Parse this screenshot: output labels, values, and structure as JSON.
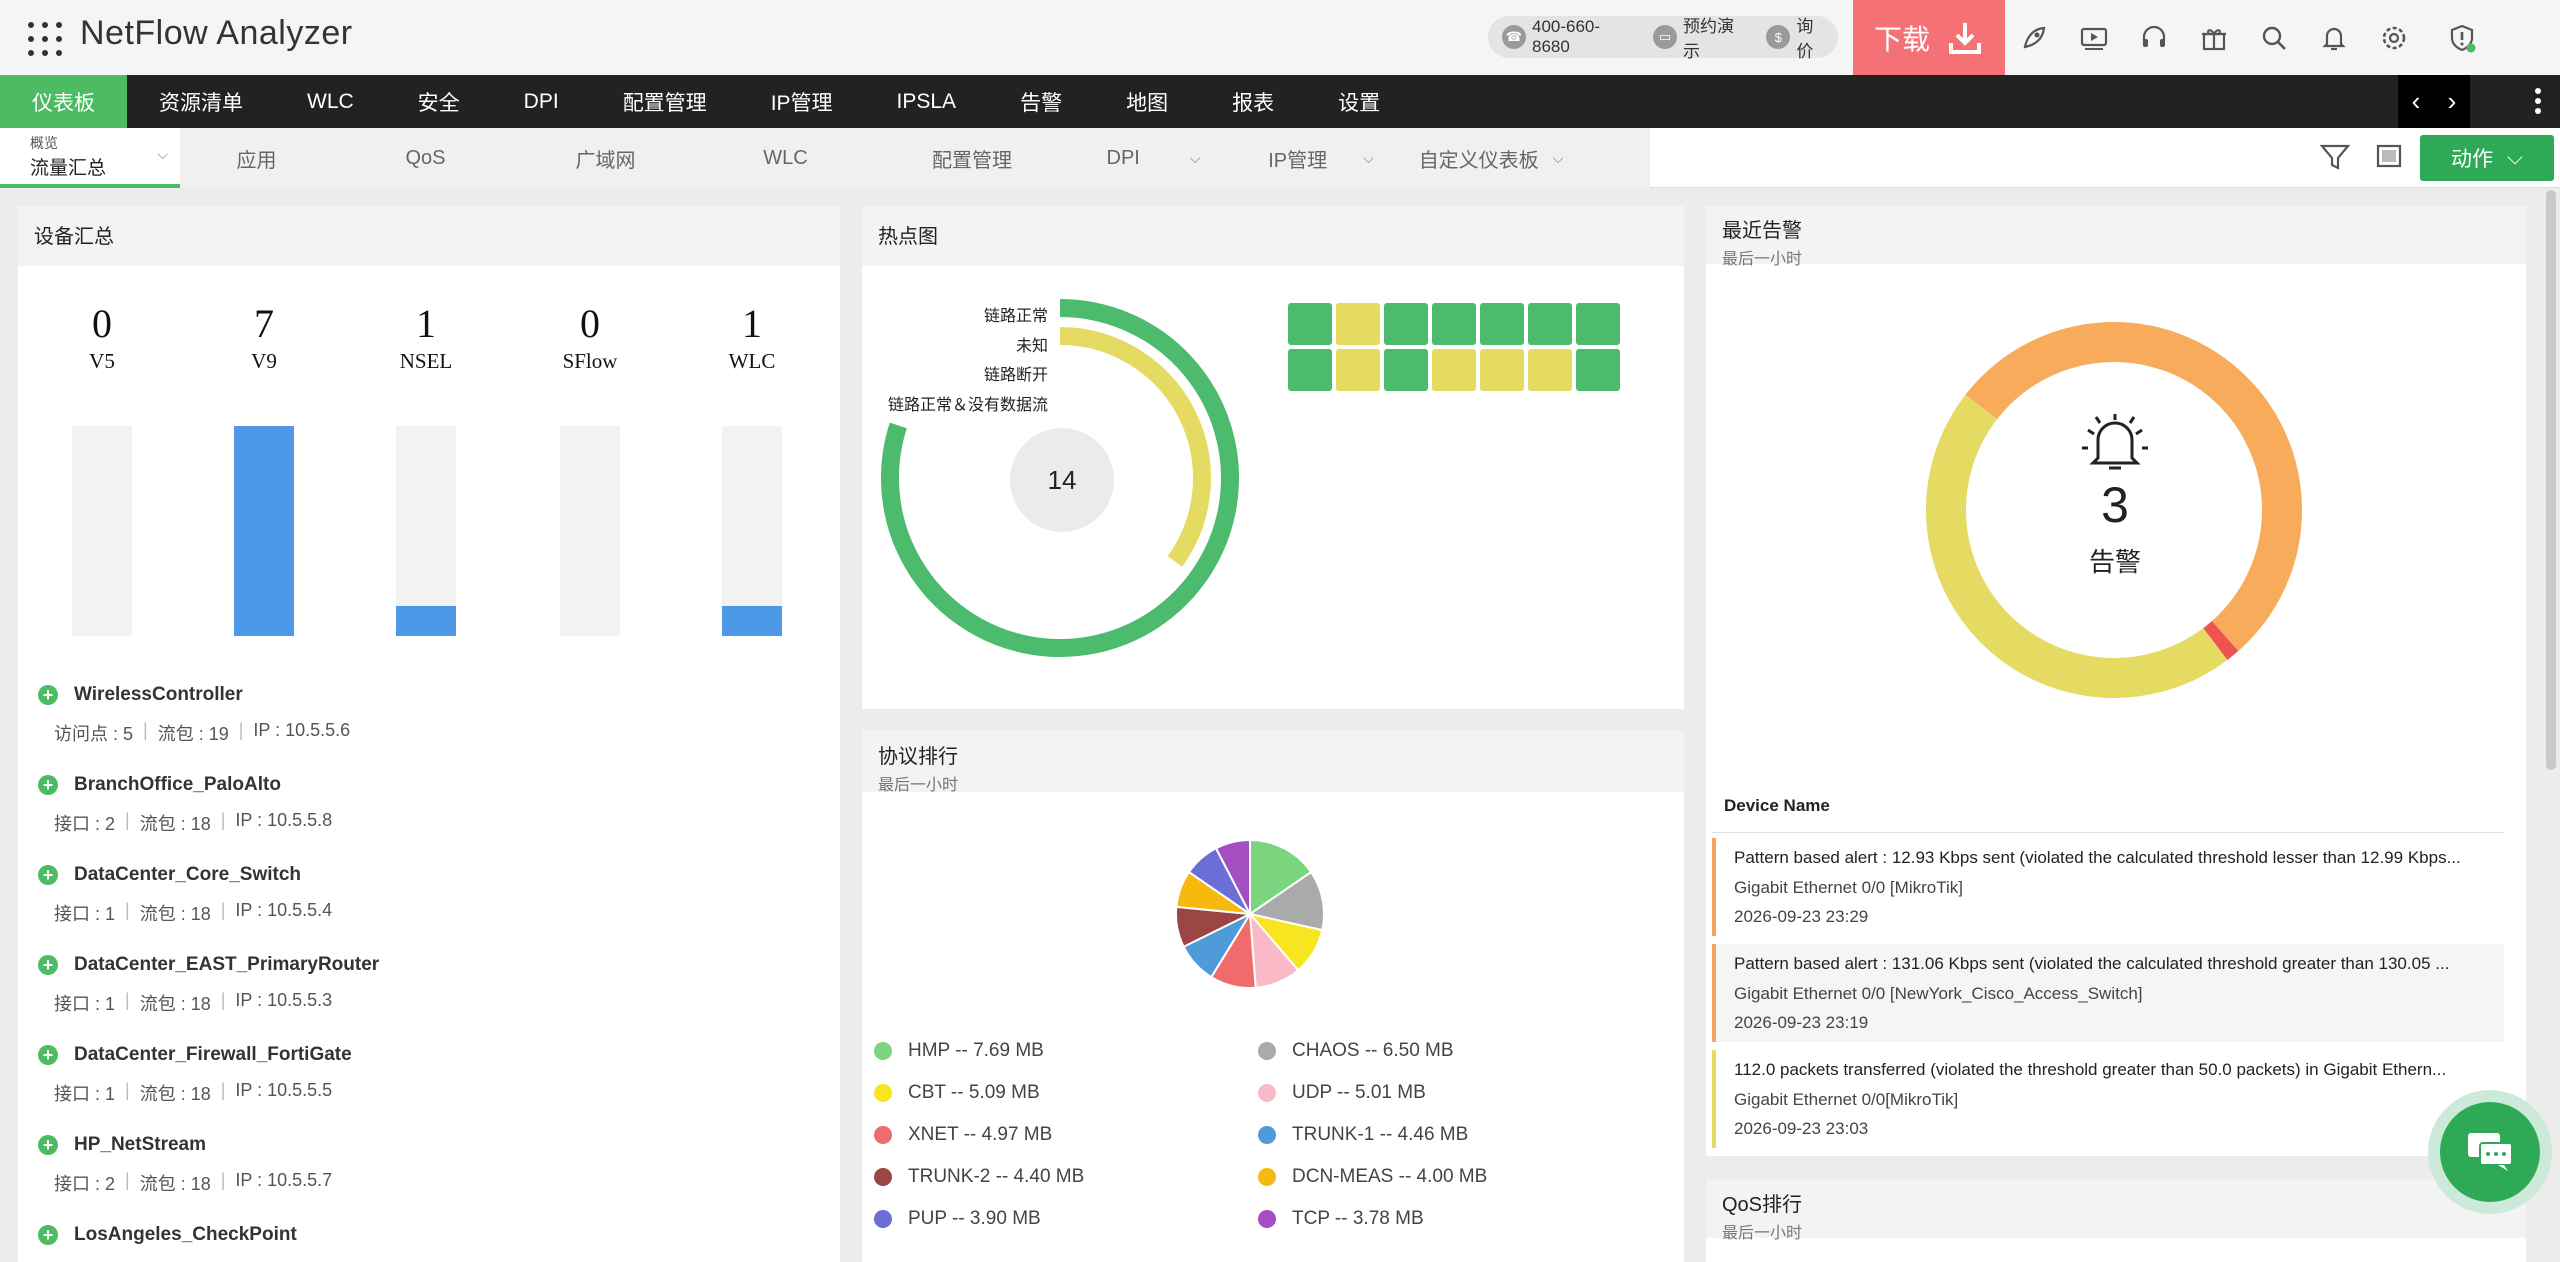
{
  "header": {
    "app_title": "NetFlow Analyzer",
    "phone": "400-660-8680",
    "demo": "预约演示",
    "price": "询价",
    "download": "下载"
  },
  "main_nav": [
    "仪表板",
    "资源清单",
    "WLC",
    "安全",
    "DPI",
    "配置管理",
    "IP管理",
    "IPSLA",
    "告警",
    "地图",
    "报表",
    "设置"
  ],
  "sub_nav": {
    "active_small": "概览",
    "active_big": "流量汇总",
    "tabs": [
      "应用",
      "QoS",
      "广域网",
      "WLC",
      "配置管理",
      "DPI",
      "IP管理",
      "自定义仪表板"
    ],
    "action": "动作"
  },
  "device_summary": {
    "title": "设备汇总",
    "counts": [
      {
        "label": "V5",
        "count": "0",
        "fraction": 0
      },
      {
        "label": "V9",
        "count": "7",
        "fraction": 1
      },
      {
        "label": "NSEL",
        "count": "1",
        "fraction": 0.143
      },
      {
        "label": "SFlow",
        "count": "0",
        "fraction": 0
      },
      {
        "label": "WLC",
        "count": "1",
        "fraction": 0.143
      }
    ],
    "devices": [
      {
        "name": "WirelessController",
        "k1": "访问点 : 5",
        "k2": "流包 : 19",
        "ip": "IP : 10.5.5.6"
      },
      {
        "name": "BranchOffice_PaloAlto",
        "k1": "接口 : 2",
        "k2": "流包 : 18",
        "ip": "IP : 10.5.5.8"
      },
      {
        "name": "DataCenter_Core_Switch",
        "k1": "接口 : 1",
        "k2": "流包 : 18",
        "ip": "IP : 10.5.5.4"
      },
      {
        "name": "DataCenter_EAST_PrimaryRouter",
        "k1": "接口 : 1",
        "k2": "流包 : 18",
        "ip": "IP : 10.5.5.3"
      },
      {
        "name": "DataCenter_Firewall_FortiGate",
        "k1": "接口 : 1",
        "k2": "流包 : 18",
        "ip": "IP : 10.5.5.5"
      },
      {
        "name": "HP_NetStream",
        "k1": "接口 : 2",
        "k2": "流包 : 18",
        "ip": "IP : 10.5.5.7"
      },
      {
        "name": "LosAngeles_CheckPoint",
        "k1": "",
        "k2": "",
        "ip": ""
      }
    ]
  },
  "heatmap": {
    "title": "热点图",
    "total": "14",
    "legend": [
      "链路正常",
      "未知",
      "链路断开",
      "链路正常＆没有数据流"
    ],
    "outer_fraction": 0.8,
    "inner_fraction": 0.35,
    "cells": [
      "g",
      "y",
      "g",
      "g",
      "g",
      "g",
      "g",
      "g",
      "y",
      "g",
      "y",
      "y",
      "y",
      "g"
    ],
    "colors": {
      "green": "#4cbb6d",
      "yellow": "#e6db62"
    }
  },
  "protocol": {
    "title": "协议排行",
    "subtitle": "最后一小时",
    "items": [
      {
        "name": "HMP -- 7.69 MB",
        "value": 7.69,
        "color": "#7bd47e"
      },
      {
        "name": "CHAOS -- 6.50 MB",
        "value": 6.5,
        "color": "#aaaaaa"
      },
      {
        "name": "CBT -- 5.09 MB",
        "value": 5.09,
        "color": "#f6e51f"
      },
      {
        "name": "UDP -- 5.01 MB",
        "value": 5.01,
        "color": "#f9b9c6"
      },
      {
        "name": "XNET -- 4.97 MB",
        "value": 4.97,
        "color": "#f06b6b"
      },
      {
        "name": "TRUNK-1 -- 4.46 MB",
        "value": 4.46,
        "color": "#4f9bd9"
      },
      {
        "name": "TRUNK-2 -- 4.40 MB",
        "value": 4.4,
        "color": "#9c4545"
      },
      {
        "name": "DCN-MEAS -- 4.00 MB",
        "value": 4.0,
        "color": "#f7b90f"
      },
      {
        "name": "PUP -- 3.90 MB",
        "value": 3.9,
        "color": "#6b6ed4"
      },
      {
        "name": "TCP -- 3.78 MB",
        "value": 3.78,
        "color": "#a34fc2"
      }
    ]
  },
  "alarms": {
    "title": "最近告警",
    "subtitle": "最后一小时",
    "count": "3",
    "label": "告警",
    "ring": {
      "orange": 0.53,
      "red": 0.012,
      "yellow": 0.458
    },
    "col_header": "Device Name",
    "items": [
      {
        "l1": "Pattern based alert : 12.93 Kbps sent (violated the calculated threshold lesser than 12.99 Kbps...",
        "l2": "Gigabit Ethernet 0/0 [MikroTik]",
        "l3": "2026-09-23 23:29",
        "color": "#f4a35d"
      },
      {
        "l1": "Pattern based alert : 131.06 Kbps sent (violated the calculated threshold greater than 130.05 ...",
        "l2": "Gigabit Ethernet 0/0 [NewYork_Cisco_Access_Switch]",
        "l3": "2026-09-23 23:19",
        "color": "#f4a35d"
      },
      {
        "l1": "112.0 packets transferred (violated the threshold greater than 50.0 packets) in Gigabit Ethern...",
        "l2": "Gigabit Ethernet 0/0[MikroTik]",
        "l3": "2026-09-23 23:03",
        "color": "#e6db62"
      }
    ]
  },
  "qos": {
    "title": "QoS排行",
    "subtitle": "最后一小时"
  }
}
